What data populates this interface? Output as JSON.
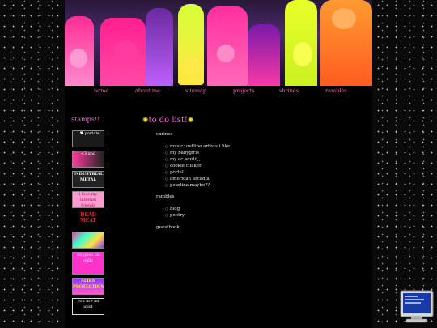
{
  "nav": {
    "items": [
      "home",
      "about me",
      "sitemap",
      "projects",
      "shrines",
      "rambles"
    ]
  },
  "sidebar": {
    "title": "stamps!!",
    "stamps": [
      {
        "text": "i ♥ portals"
      },
      {
        "text": "<3  and"
      },
      {
        "text": "INDUSTRIAL METAL"
      },
      {
        "text": "i love my internet friends"
      },
      {
        "text": "DEAD MEAT"
      },
      {
        "text": ""
      },
      {
        "text": "oh gosh oh golly"
      },
      {
        "text": "ALIEN PROTECTION"
      },
      {
        "text": "you are an idiot"
      }
    ]
  },
  "main": {
    "title": "to do list!",
    "sections": [
      {
        "label": "shrines",
        "items": [
          "music; outline artists i like",
          "my babygirls",
          "my oc world,,",
          "cookie clicker",
          "portal",
          "american arcadia",
          "pearlina maybe??"
        ]
      },
      {
        "label": "rambles",
        "items": [
          "blog",
          "poetry"
        ]
      },
      {
        "label": "guestbook",
        "items": []
      }
    ]
  },
  "colors": {
    "accent_pink": "#ff66cc",
    "star_yellow": "#ffdd33",
    "text": "#e8e8e8"
  }
}
